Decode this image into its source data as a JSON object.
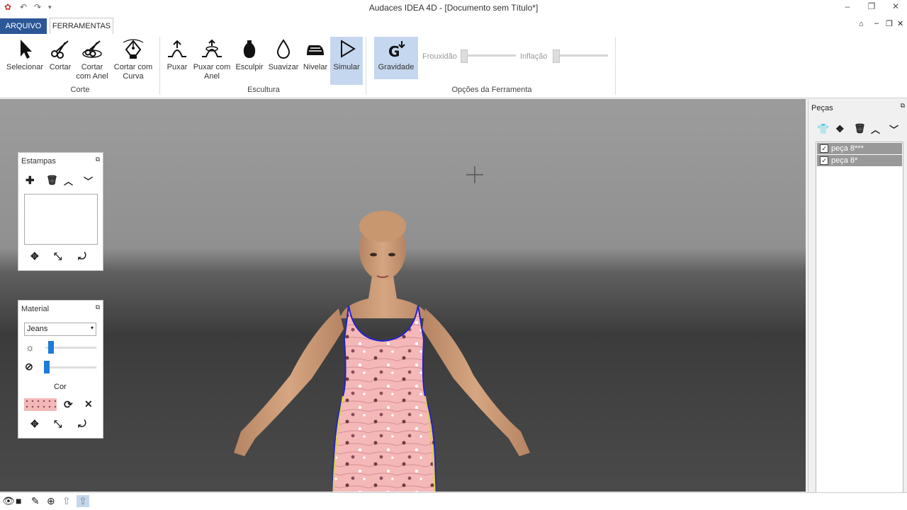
{
  "window": {
    "title": "Audaces IDEA 4D - [Documento sem Título*]"
  },
  "tabs": {
    "file": "ARQUIVO",
    "tools": "FERRAMENTAS"
  },
  "ribbon": {
    "corte": {
      "label": "Corte",
      "items": [
        {
          "name": "Selecionar",
          "icon": "cursor-icon"
        },
        {
          "name": "Cortar",
          "icon": "scissors-icon"
        },
        {
          "name": "Cortar com Anel",
          "icon": "scissors-ring-icon"
        },
        {
          "name": "Cortar com Curva",
          "icon": "pen-curve-icon"
        }
      ]
    },
    "escultura": {
      "label": "Escultura",
      "items": [
        {
          "name": "Puxar",
          "icon": "pull-icon"
        },
        {
          "name": "Puxar com Anel",
          "icon": "pull-ring-icon"
        },
        {
          "name": "Esculpir",
          "icon": "vase-icon"
        },
        {
          "name": "Suavizar",
          "icon": "drop-icon"
        },
        {
          "name": "Nivelar",
          "icon": "iron-icon"
        },
        {
          "name": "Simular",
          "icon": "play-icon",
          "active": true
        }
      ]
    },
    "opcoes": {
      "label": "Opções da Ferramenta",
      "gravity": "Gravidade",
      "slack": "Frouxidão",
      "inflation": "Inflação"
    }
  },
  "estampas": {
    "title": "Estampas"
  },
  "material": {
    "title": "Material",
    "selected": "Jeans",
    "color_label": "Cor",
    "brightness": 0.1,
    "transparency": 0.0
  },
  "pecas": {
    "title": "Peças",
    "items": [
      {
        "label": "peça 8***",
        "checked": true
      },
      {
        "label": "peça 8*",
        "checked": true
      }
    ]
  },
  "colors": {
    "accent": "#2b5797",
    "active_tool": "#c5d7ee",
    "dress": "#f4b8b8",
    "seam": "#2222cc"
  }
}
